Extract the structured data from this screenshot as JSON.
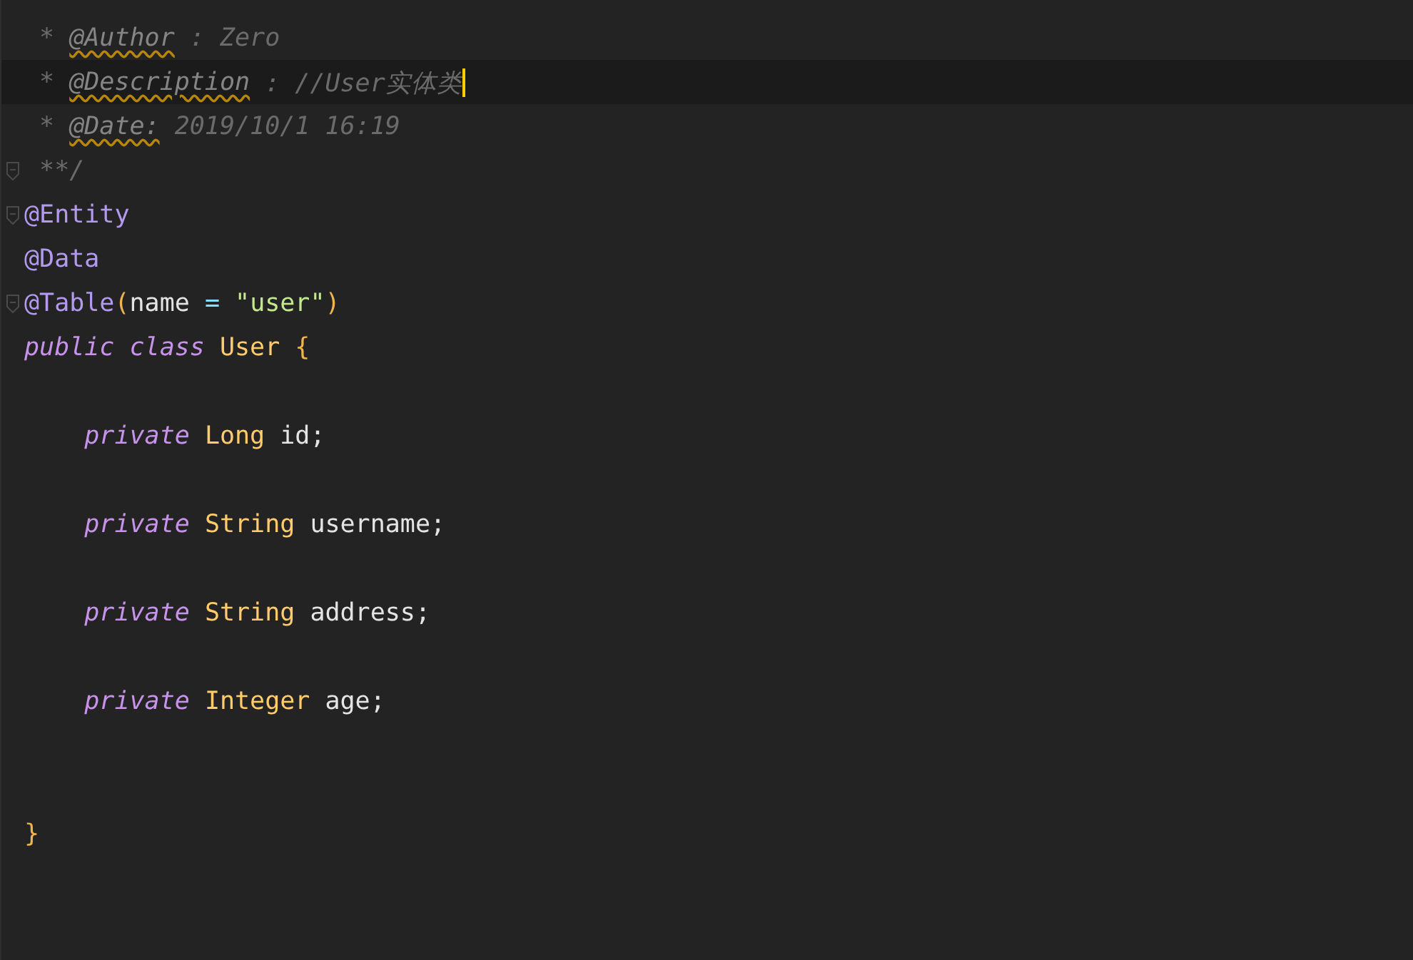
{
  "editor": {
    "lines": [
      {
        "current": false,
        "fold": false,
        "tokens": [
          {
            "kind": "comment",
            "text": " * "
          },
          {
            "kind": "doc-tag",
            "text": "@Author"
          },
          {
            "kind": "comment",
            "text": " : Zero"
          }
        ]
      },
      {
        "current": true,
        "fold": false,
        "tokens": [
          {
            "kind": "comment",
            "text": " * "
          },
          {
            "kind": "doc-tag",
            "text": "@Description"
          },
          {
            "kind": "comment",
            "text": " : //User实体类"
          }
        ]
      },
      {
        "current": false,
        "fold": false,
        "tokens": [
          {
            "kind": "comment",
            "text": " * "
          },
          {
            "kind": "doc-tag",
            "text": "@Date:"
          },
          {
            "kind": "comment",
            "text": " 2019/10/1 16:19"
          }
        ]
      },
      {
        "current": false,
        "fold": true,
        "tokens": [
          {
            "kind": "comment",
            "text": " **/"
          }
        ]
      },
      {
        "current": false,
        "fold": true,
        "tokens": [
          {
            "kind": "annotation",
            "text": "@Entity"
          }
        ]
      },
      {
        "current": false,
        "fold": false,
        "tokens": [
          {
            "kind": "annotation",
            "text": "@Data"
          }
        ]
      },
      {
        "current": false,
        "fold": true,
        "tokens": [
          {
            "kind": "annotation",
            "text": "@Table"
          },
          {
            "kind": "paren",
            "text": "("
          },
          {
            "kind": "plain",
            "text": "name "
          },
          {
            "kind": "operator",
            "text": "= "
          },
          {
            "kind": "string",
            "text": "\"user\""
          },
          {
            "kind": "paren",
            "text": ")"
          }
        ]
      },
      {
        "current": false,
        "fold": false,
        "tokens": [
          {
            "kind": "keyword",
            "text": "public class "
          },
          {
            "kind": "type",
            "text": "User "
          },
          {
            "kind": "paren",
            "text": "{"
          }
        ]
      },
      {
        "current": false,
        "fold": false
      },
      {
        "current": false,
        "fold": false,
        "tokens": [
          {
            "kind": "keyword",
            "text": "    private "
          },
          {
            "kind": "type",
            "text": "Long "
          },
          {
            "kind": "plain",
            "text": "id;"
          }
        ]
      },
      {
        "current": false,
        "fold": false
      },
      {
        "current": false,
        "fold": false,
        "tokens": [
          {
            "kind": "keyword",
            "text": "    private "
          },
          {
            "kind": "type",
            "text": "String "
          },
          {
            "kind": "plain",
            "text": "username;"
          }
        ]
      },
      {
        "current": false,
        "fold": false
      },
      {
        "current": false,
        "fold": false,
        "tokens": [
          {
            "kind": "keyword",
            "text": "    private "
          },
          {
            "kind": "type",
            "text": "String "
          },
          {
            "kind": "plain",
            "text": "address;"
          }
        ]
      },
      {
        "current": false,
        "fold": false
      },
      {
        "current": false,
        "fold": false,
        "tokens": [
          {
            "kind": "keyword",
            "text": "    private "
          },
          {
            "kind": "type",
            "text": "Integer "
          },
          {
            "kind": "plain",
            "text": "age;"
          }
        ]
      },
      {
        "current": false,
        "fold": false
      },
      {
        "current": false,
        "fold": false
      },
      {
        "current": false,
        "fold": false,
        "tokens": [
          {
            "kind": "paren",
            "text": "}"
          }
        ]
      }
    ]
  }
}
